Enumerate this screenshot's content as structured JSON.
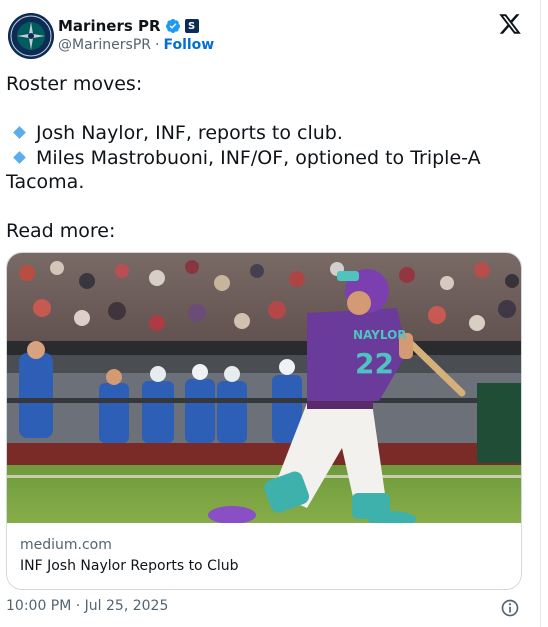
{
  "author": {
    "display_name": "Mariners PR",
    "handle": "@MarinersPR",
    "separator": "·",
    "follow_label": "Follow",
    "team_badge": "S",
    "verified_icon": "verified-badge-icon",
    "brand_color": "#0c2c56",
    "accent_color": "#1d9bf0"
  },
  "platform_logo": "x-logo-icon",
  "post": {
    "line1": "Roster moves:",
    "bullet1": "Josh Naylor, INF, reports to club.",
    "bullet2": "Miles Mastrobuoni, INF/OF, optioned to Triple-A",
    "bullet2_cont": "Tacoma.",
    "line_read_more": "Read more:",
    "bullet_icon": "small-blue-diamond-icon"
  },
  "link_card": {
    "domain": "medium.com",
    "title": "INF Josh Naylor Reports to Club",
    "image_desc_icon": "baseball-player-photo",
    "jersey_name": "NAYLOR",
    "jersey_number": "22"
  },
  "footer": {
    "timestamp": "10:00 PM · Jul 25, 2025",
    "info_icon": "info-icon"
  }
}
